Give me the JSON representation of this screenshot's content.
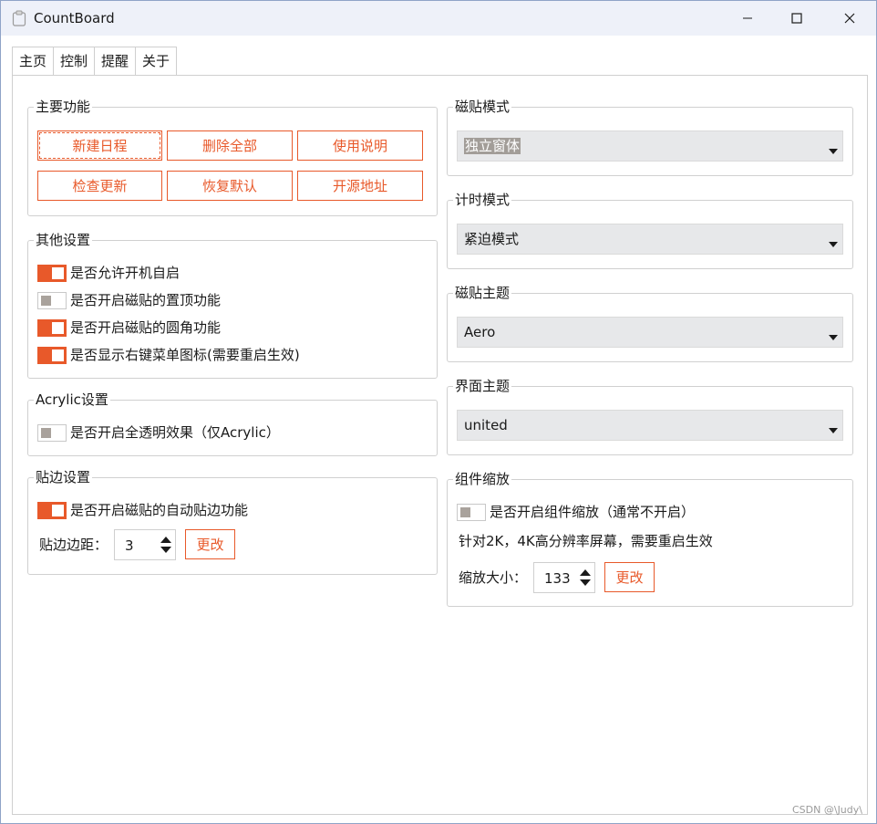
{
  "window": {
    "title": "CountBoard",
    "icon": "clipboard-icon"
  },
  "tabs": [
    {
      "label": "主页",
      "active": true
    },
    {
      "label": "控制",
      "active": false
    },
    {
      "label": "提醒",
      "active": false
    },
    {
      "label": "关于",
      "active": false
    }
  ],
  "main_functions": {
    "title": "主要功能",
    "buttons": [
      "新建日程",
      "删除全部",
      "使用说明",
      "检查更新",
      "恢复默认",
      "开源地址"
    ]
  },
  "other_settings": {
    "title": "其他设置",
    "items": [
      {
        "label": "是否允许开机自启",
        "on": true
      },
      {
        "label": "是否开启磁贴的置顶功能",
        "on": false
      },
      {
        "label": "是否开启磁贴的圆角功能",
        "on": true
      },
      {
        "label": "是否显示右键菜单图标(需要重启生效)",
        "on": true
      }
    ]
  },
  "acrylic_settings": {
    "title": "Acrylic设置",
    "items": [
      {
        "label": "是否开启全透明效果（仅Acrylic）",
        "on": false
      }
    ]
  },
  "edge_settings": {
    "title": "贴边设置",
    "items": [
      {
        "label": "是否开启磁贴的自动贴边功能",
        "on": true
      }
    ],
    "margin_label": "贴边边距：",
    "margin_value": "3",
    "change_label": "更改"
  },
  "tile_mode": {
    "title": "磁贴模式",
    "value": "独立窗体"
  },
  "timer_mode": {
    "title": "计时模式",
    "value": "紧迫模式"
  },
  "tile_theme": {
    "title": "磁贴主题",
    "value": "Aero"
  },
  "ui_theme": {
    "title": "界面主题",
    "value": "united"
  },
  "component_scaling": {
    "title": "组件缩放",
    "toggle_label": "是否开启组件缩放（通常不开启）",
    "toggle_on": false,
    "hint": "针对2K，4K高分辨率屏幕，需要重启生效",
    "size_label": "缩放大小：",
    "size_value": "133",
    "change_label": "更改"
  },
  "watermark": "CSDN @\\Judy\\",
  "colors": {
    "accent": "#e8592a",
    "titlebar": "#eef1f9",
    "combo_bg": "#e7e8ea"
  }
}
